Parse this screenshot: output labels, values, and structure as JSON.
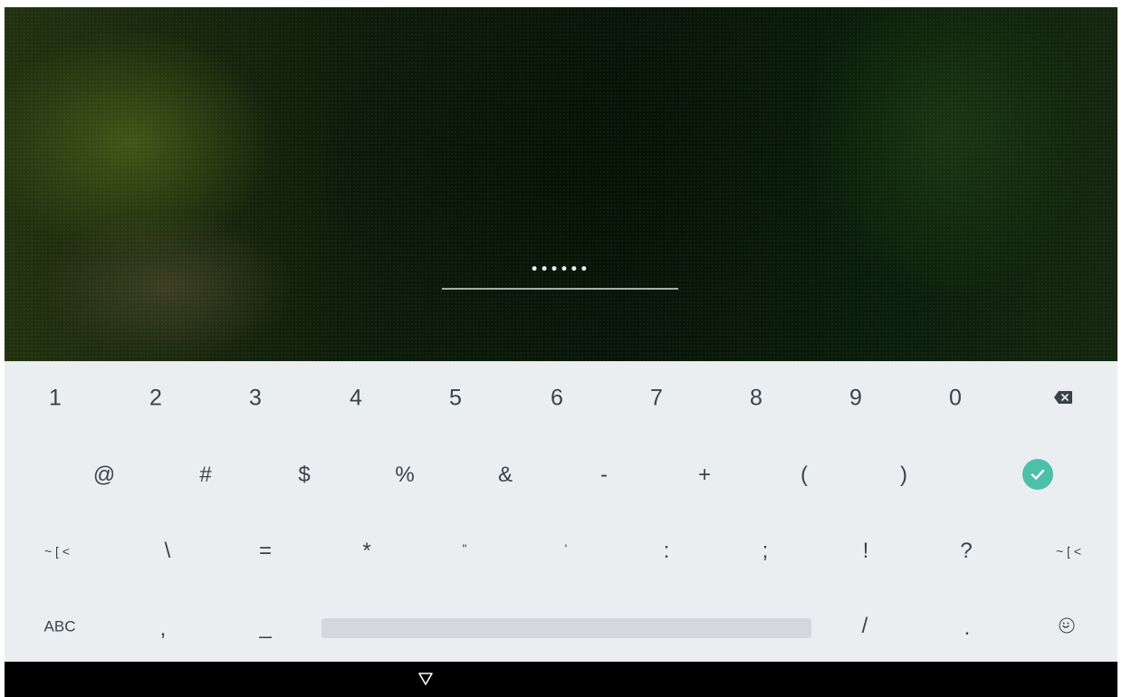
{
  "pin_field": {
    "value": "••••••"
  },
  "keyboard": {
    "row1": [
      "1",
      "2",
      "3",
      "4",
      "5",
      "6",
      "7",
      "8",
      "9",
      "0"
    ],
    "row2": [
      "@",
      "#",
      "$",
      "%",
      "&",
      "-",
      "+",
      "(",
      ")"
    ],
    "row3": [
      "~ [ <",
      "\\",
      "=",
      "*",
      "\"",
      "'",
      ":",
      ";",
      "!",
      "?",
      "~ [ <"
    ],
    "row4": {
      "abc": "ABC",
      "comma": ",",
      "underscore": "_",
      "slash": "/",
      "period": "."
    },
    "icons": {
      "backspace": "backspace-icon",
      "enter": "check-circle-icon",
      "emoji": "emoji-icon",
      "nav_back": "triangle-down-icon"
    },
    "colors": {
      "enter": "#4ebfa8",
      "background": "#ebeef1",
      "key_text": "#3b4347"
    }
  }
}
